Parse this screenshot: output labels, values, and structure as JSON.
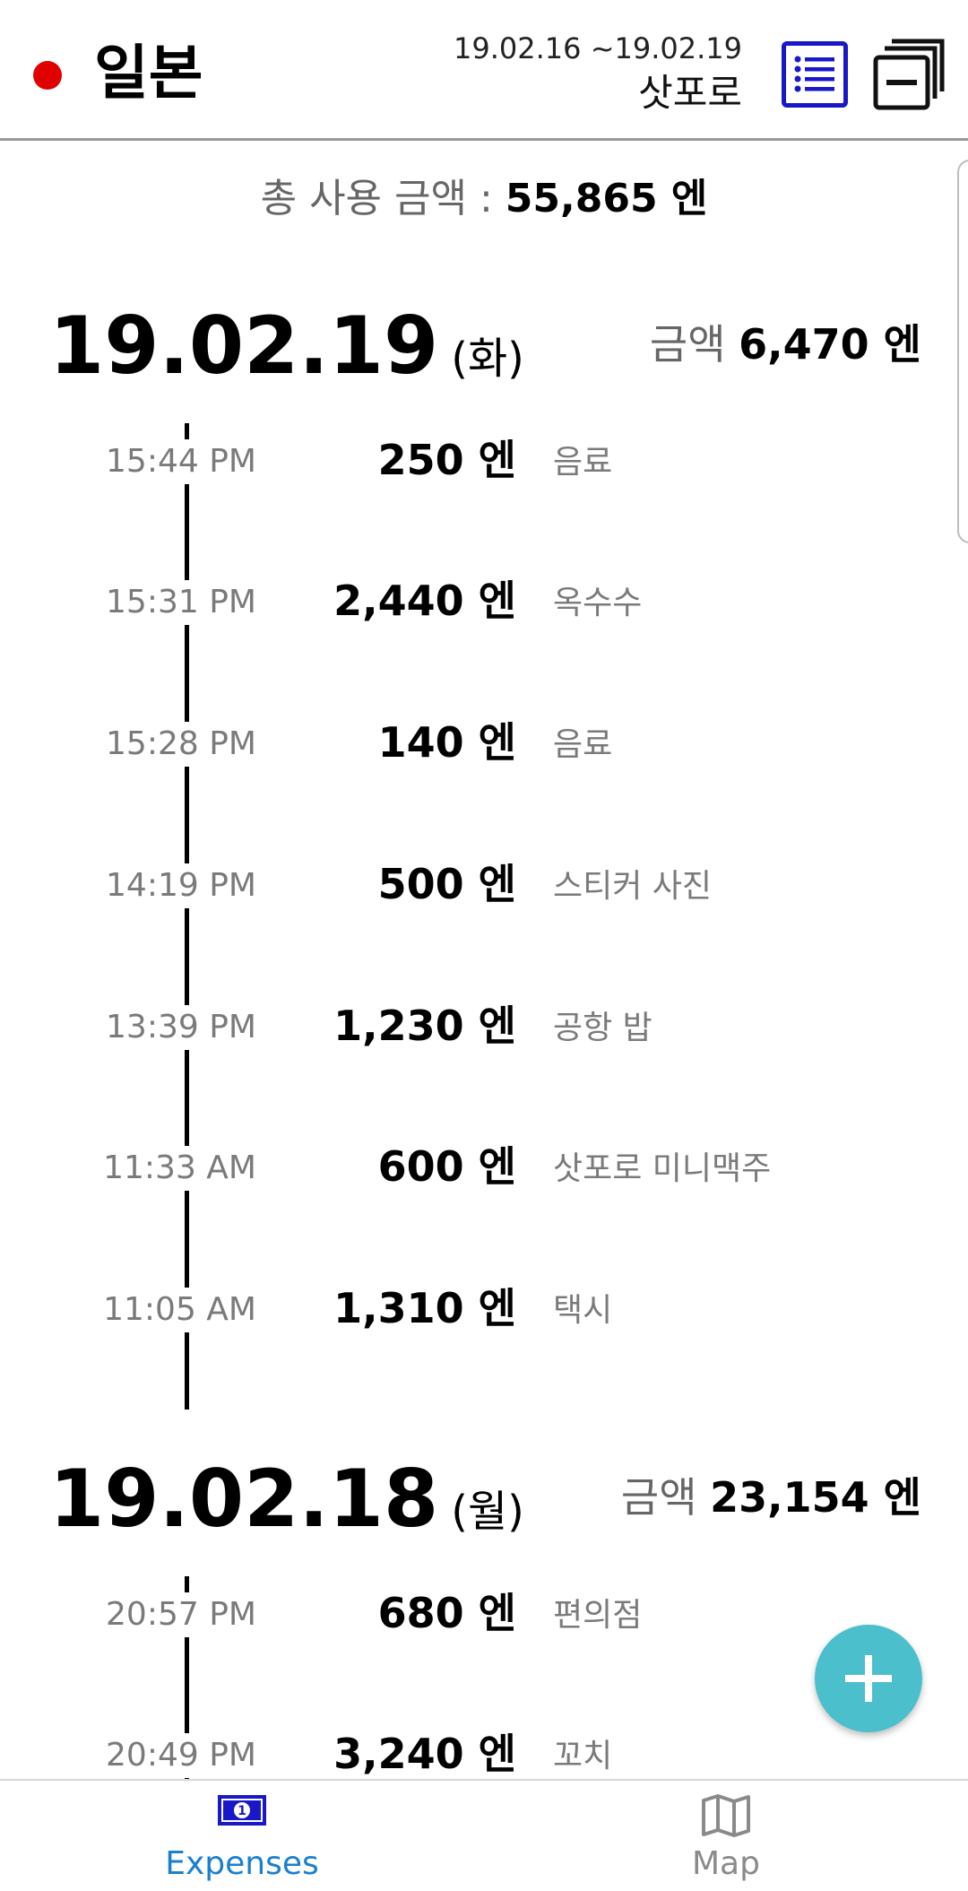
{
  "header": {
    "country": "일본",
    "date_range": "19.02.16 ~19.02.19",
    "city": "삿포로",
    "flag_color": "#e00000",
    "list_icon": "list-icon",
    "copy_icon": "copy-windows-icon"
  },
  "summary": {
    "total_label": "총 사용 금액 : ",
    "total_amount": "55,865 엔"
  },
  "days": [
    {
      "date": "19.02.19",
      "weekday": "(화)",
      "sum_label": "금액 ",
      "sum_amount": "6,470 엔",
      "entries": [
        {
          "time": "15:44 PM",
          "amount": "250 엔",
          "category": "음료"
        },
        {
          "time": "15:31 PM",
          "amount": "2,440 엔",
          "category": "옥수수"
        },
        {
          "time": "15:28 PM",
          "amount": "140 엔",
          "category": "음료"
        },
        {
          "time": "14:19 PM",
          "amount": "500 엔",
          "category": "스티커 사진"
        },
        {
          "time": "13:39 PM",
          "amount": "1,230 엔",
          "category": "공항 밥"
        },
        {
          "time": "11:33 AM",
          "amount": "600 엔",
          "category": "삿포로 미니맥주"
        },
        {
          "time": "11:05 AM",
          "amount": "1,310 엔",
          "category": "택시"
        }
      ]
    },
    {
      "date": "19.02.18",
      "weekday": "(월)",
      "sum_label": "금액 ",
      "sum_amount": "23,154 엔",
      "entries": [
        {
          "time": "20:57 PM",
          "amount": "680 엔",
          "category": "편의점"
        },
        {
          "time": "20:49 PM",
          "amount": "3,240 엔",
          "category": "꼬치"
        }
      ]
    }
  ],
  "fab": {
    "icon": "plus-icon",
    "color": "#4cbfcc"
  },
  "nav": {
    "expenses_label": "Expenses",
    "map_label": "Map",
    "active_color": "#1a7fd0",
    "inactive_color": "#8a8a8a"
  }
}
